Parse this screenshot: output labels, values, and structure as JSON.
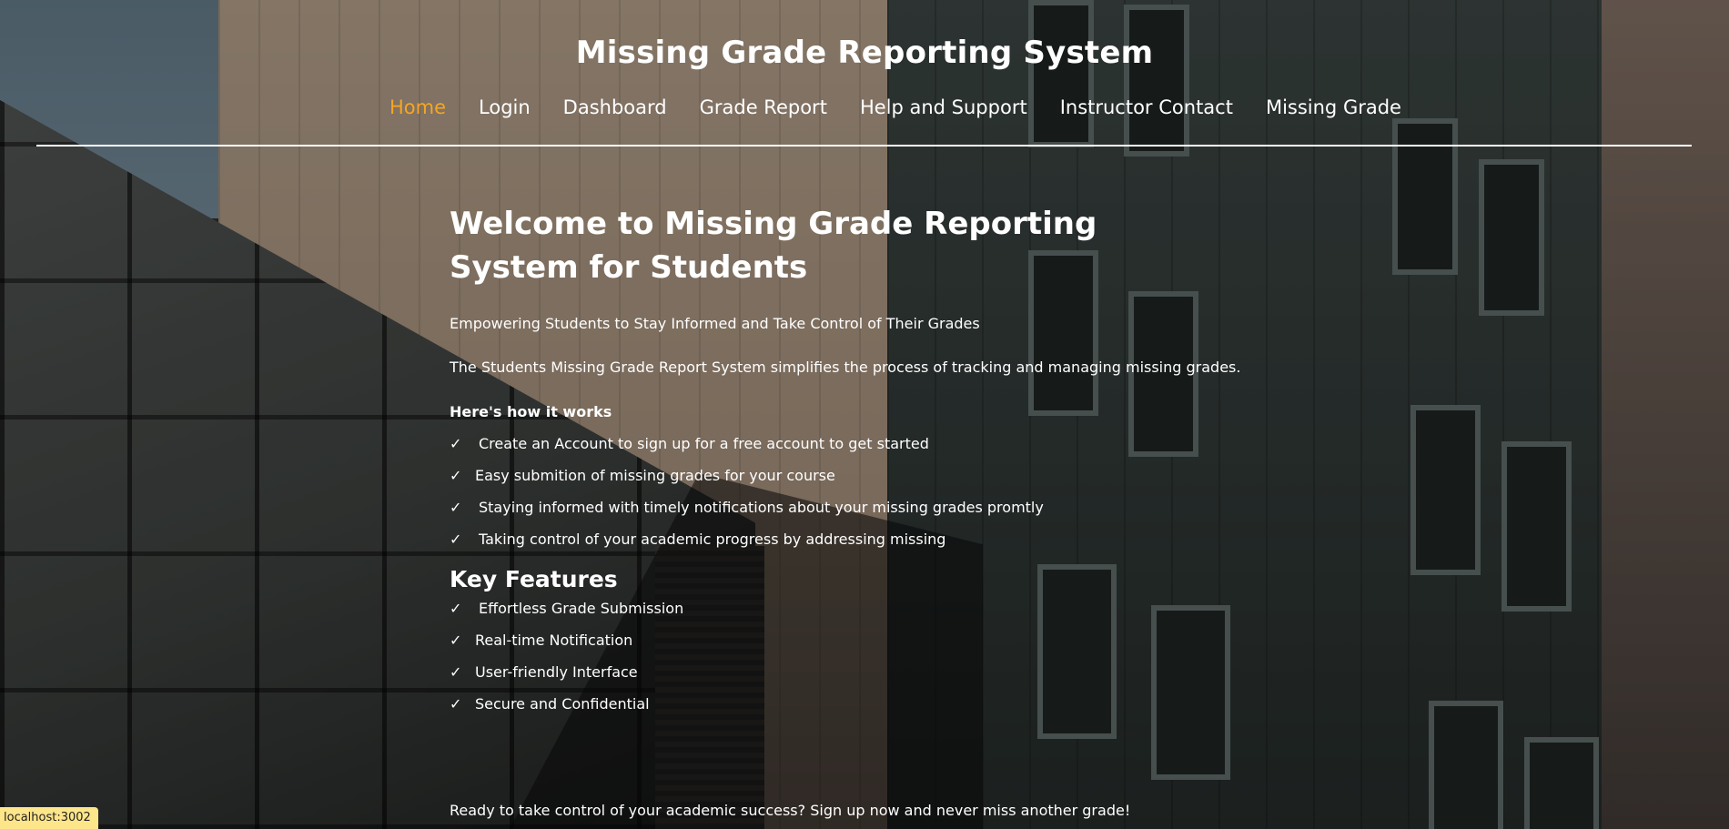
{
  "site_title": "Missing Grade Reporting System",
  "nav": {
    "home": "Home",
    "login": "Login",
    "dashboard": "Dashboard",
    "grade_report": "Grade Report",
    "help": "Help and Support",
    "instructor": "Instructor Contact",
    "missing": "Missing Grade",
    "active": "Home",
    "active_color": "#f5a623"
  },
  "main": {
    "welcome": "Welcome to Missing Grade Reporting System for Students",
    "tagline": "Empowering Students to Stay Informed and Take Control of Their Grades",
    "description": "The Students Missing Grade Report System simplifies the process of tracking and managing missing grades.",
    "how_heading": "Here's how it works",
    "check_mark": "✓",
    "how_items": [
      "Create an Account to sign up for a free account to get started",
      "Easy submition of missing grades for your course",
      "Staying informed with timely notifications about your missing grades promtly",
      "Taking control of your academic progress by addressing missing"
    ],
    "features_heading": "Key Features",
    "features": [
      "Effortless Grade Submission",
      "Real-time Notification",
      "User-friendly Interface",
      "Secure and Confidential"
    ],
    "cta": "Ready to take control of your academic success? Sign up now and never miss another grade!"
  },
  "status_bar": "localhost:3002"
}
